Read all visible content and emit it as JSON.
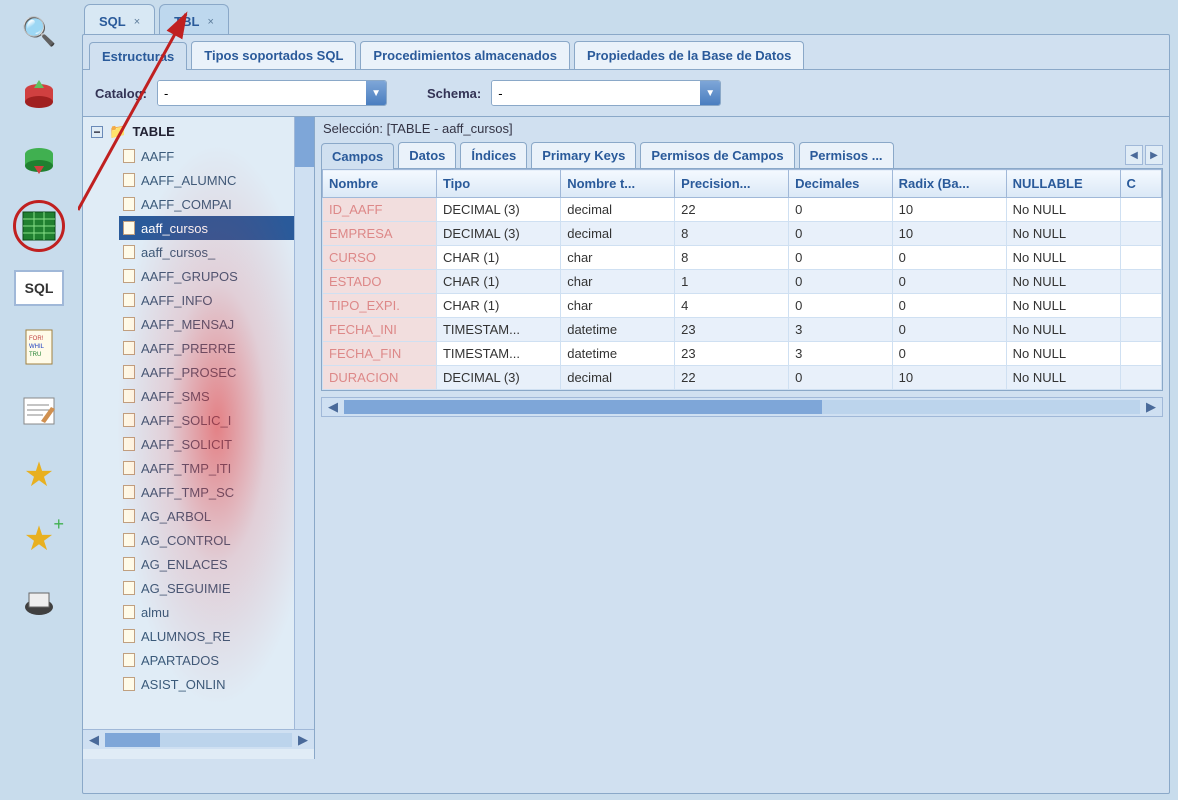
{
  "iconbar": {
    "items": [
      {
        "name": "search-icon",
        "glyph": "🔍"
      },
      {
        "name": "db-import-icon",
        "glyph": "🔴▼"
      },
      {
        "name": "db-export-icon",
        "glyph": "🟢▼"
      },
      {
        "name": "table-editor-icon",
        "glyph": "▦"
      },
      {
        "name": "sql-editor-icon",
        "glyph": "SQL"
      },
      {
        "name": "script-editor-icon",
        "glyph": "📋"
      },
      {
        "name": "notes-icon",
        "glyph": "📝"
      },
      {
        "name": "favorites-icon",
        "glyph": "⭐"
      },
      {
        "name": "add-favorite-icon",
        "glyph": "✨"
      },
      {
        "name": "print-icon",
        "glyph": "🖨️"
      }
    ]
  },
  "file_tabs": [
    {
      "label": "SQL",
      "active": false
    },
    {
      "label": "TBL",
      "active": true
    }
  ],
  "big_tabs": [
    {
      "label": "Estructuras",
      "active": true
    },
    {
      "label": "Tipos soportados SQL",
      "active": false
    },
    {
      "label": "Procedimientos almacenados",
      "active": false
    },
    {
      "label": "Propiedades de la Base de Datos",
      "active": false
    }
  ],
  "filters": {
    "catalog_label": "Catalog:",
    "catalog_value": "-",
    "schema_label": "Schema:",
    "schema_value": "-"
  },
  "tree": {
    "root_label": "TABLE",
    "selected": "aaff_cursos",
    "items": [
      "AAFF",
      "AAFF_ALUMNC",
      "AAFF_COMPAI",
      "aaff_cursos",
      "aaff_cursos_",
      "AAFF_GRUPOS",
      "AAFF_INFO",
      "AAFF_MENSAJ",
      "AAFF_PRERRE",
      "AAFF_PROSEC",
      "AAFF_SMS",
      "AAFF_SOLIC_I",
      "AAFF_SOLICIT",
      "AAFF_TMP_ITI",
      "AAFF_TMP_SC",
      "AG_ARBOL",
      "AG_CONTROL",
      "AG_ENLACES",
      "AG_SEGUIMIE",
      "almu",
      "ALUMNOS_RE",
      "APARTADOS",
      "ASIST_ONLIN"
    ]
  },
  "selection_label": "Selección: [TABLE - aaff_cursos]",
  "sub_tabs": [
    {
      "label": "Campos",
      "active": true
    },
    {
      "label": "Datos",
      "active": false
    },
    {
      "label": "Índices",
      "active": false
    },
    {
      "label": "Primary Keys",
      "active": false
    },
    {
      "label": "Permisos de Campos",
      "active": false
    },
    {
      "label": "Permisos ...",
      "active": false
    }
  ],
  "grid": {
    "columns": [
      "Nombre",
      "Tipo",
      "Nombre t...",
      "Precision...",
      "Decimales",
      "Radix (Ba...",
      "NULLABLE",
      "C"
    ],
    "rows": [
      [
        "ID_AAFF",
        "DECIMAL (3)",
        "decimal",
        "22",
        "0",
        "10",
        "No NULL",
        ""
      ],
      [
        "EMPRESA",
        "DECIMAL (3)",
        "decimal",
        "8",
        "0",
        "10",
        "No NULL",
        ""
      ],
      [
        "CURSO",
        "CHAR (1)",
        "char",
        "8",
        "0",
        "0",
        "No NULL",
        ""
      ],
      [
        "ESTADO",
        "CHAR (1)",
        "char",
        "1",
        "0",
        "0",
        "No NULL",
        ""
      ],
      [
        "TIPO_EXPI.",
        "CHAR (1)",
        "char",
        "4",
        "0",
        "0",
        "No NULL",
        ""
      ],
      [
        "FECHA_INI",
        "TIMESTAM...",
        "datetime",
        "23",
        "3",
        "0",
        "No NULL",
        ""
      ],
      [
        "FECHA_FIN",
        "TIMESTAM...",
        "datetime",
        "23",
        "3",
        "0",
        "No NULL",
        ""
      ],
      [
        "DURACION",
        "DECIMAL (3)",
        "decimal",
        "22",
        "0",
        "10",
        "No NULL",
        ""
      ]
    ]
  }
}
